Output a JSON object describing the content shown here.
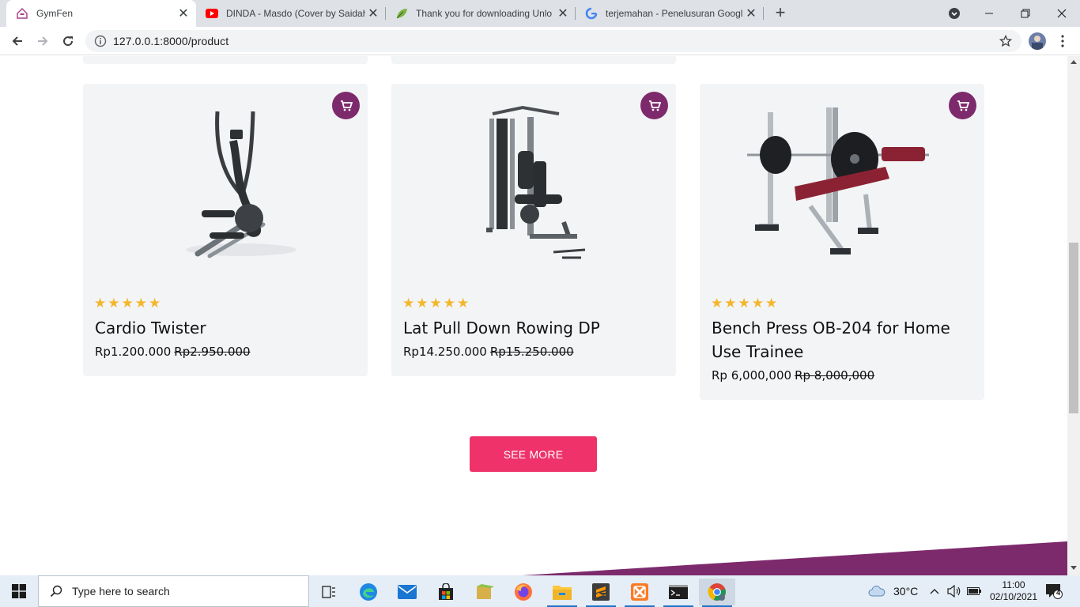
{
  "browser": {
    "tabs": [
      {
        "title": "GymFen",
        "icon": "gym-house-icon",
        "active": true
      },
      {
        "title": "DINDA - Masdo (Cover by Saidah",
        "icon": "youtube-icon",
        "active": false
      },
      {
        "title": "Thank you for downloading Unlo",
        "icon": "leaf-icon",
        "active": false
      },
      {
        "title": "terjemahan - Penelusuran Google",
        "icon": "google-icon",
        "active": false
      }
    ],
    "new_tab": "+",
    "url": "127.0.0.1:8000/product"
  },
  "products": [
    {
      "name": "Cardio Twister",
      "price": "Rp1.200.000",
      "old_price": "Rp2.950.000",
      "rating": 5,
      "image": "elliptical-trainer"
    },
    {
      "name": "Lat Pull Down Rowing DP",
      "price": "Rp14.250.000",
      "old_price": "Rp15.250.000",
      "rating": 5,
      "image": "home-gym-station"
    },
    {
      "name": "Bench Press OB-204 for Home Use Trainee",
      "price": "Rp 6,000,000",
      "old_price": "Rp 8,000,000",
      "rating": 5,
      "image": "bench-press"
    }
  ],
  "see_more_label": "SEE MORE",
  "colors": {
    "accent": "#ef3269",
    "cart": "#7d2a6d",
    "star": "#f4b62b",
    "card_bg": "#f3f4f6",
    "footer": "#7d2a6d"
  },
  "taskbar": {
    "search_placeholder": "Type here to search",
    "weather": "30°C",
    "time": "11:00",
    "date": "02/10/2021",
    "notifications": "4"
  }
}
